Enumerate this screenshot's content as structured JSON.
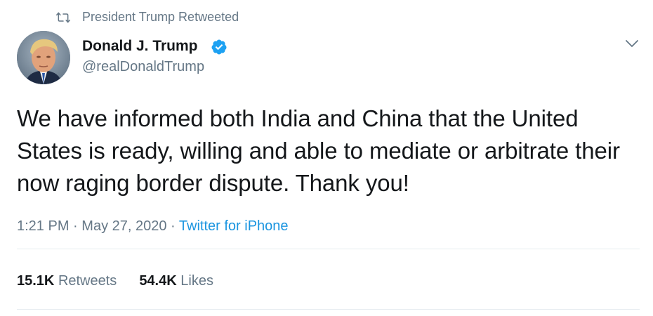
{
  "retweet_context": {
    "label": "President Trump Retweeted",
    "icon": "retweet-icon"
  },
  "author": {
    "display_name": "Donald J. Trump",
    "handle": "@realDonaldTrump",
    "verified": true,
    "verified_color": "#1da1f2"
  },
  "tweet": {
    "text": "We have informed both India and China that the United States is ready, willing and able to mediate or arbitrate their now raging border dispute. Thank you!"
  },
  "meta": {
    "time": "1:21 PM",
    "separator": "·",
    "date": "May 27, 2020",
    "source": "Twitter for iPhone"
  },
  "stats": {
    "retweets_count": "15.1K",
    "retweets_label": "Retweets",
    "likes_count": "54.4K",
    "likes_label": "Likes"
  },
  "colors": {
    "text": "#14171a",
    "secondary": "#657786",
    "link": "#1b95e0",
    "divider": "#e6ecf0"
  }
}
